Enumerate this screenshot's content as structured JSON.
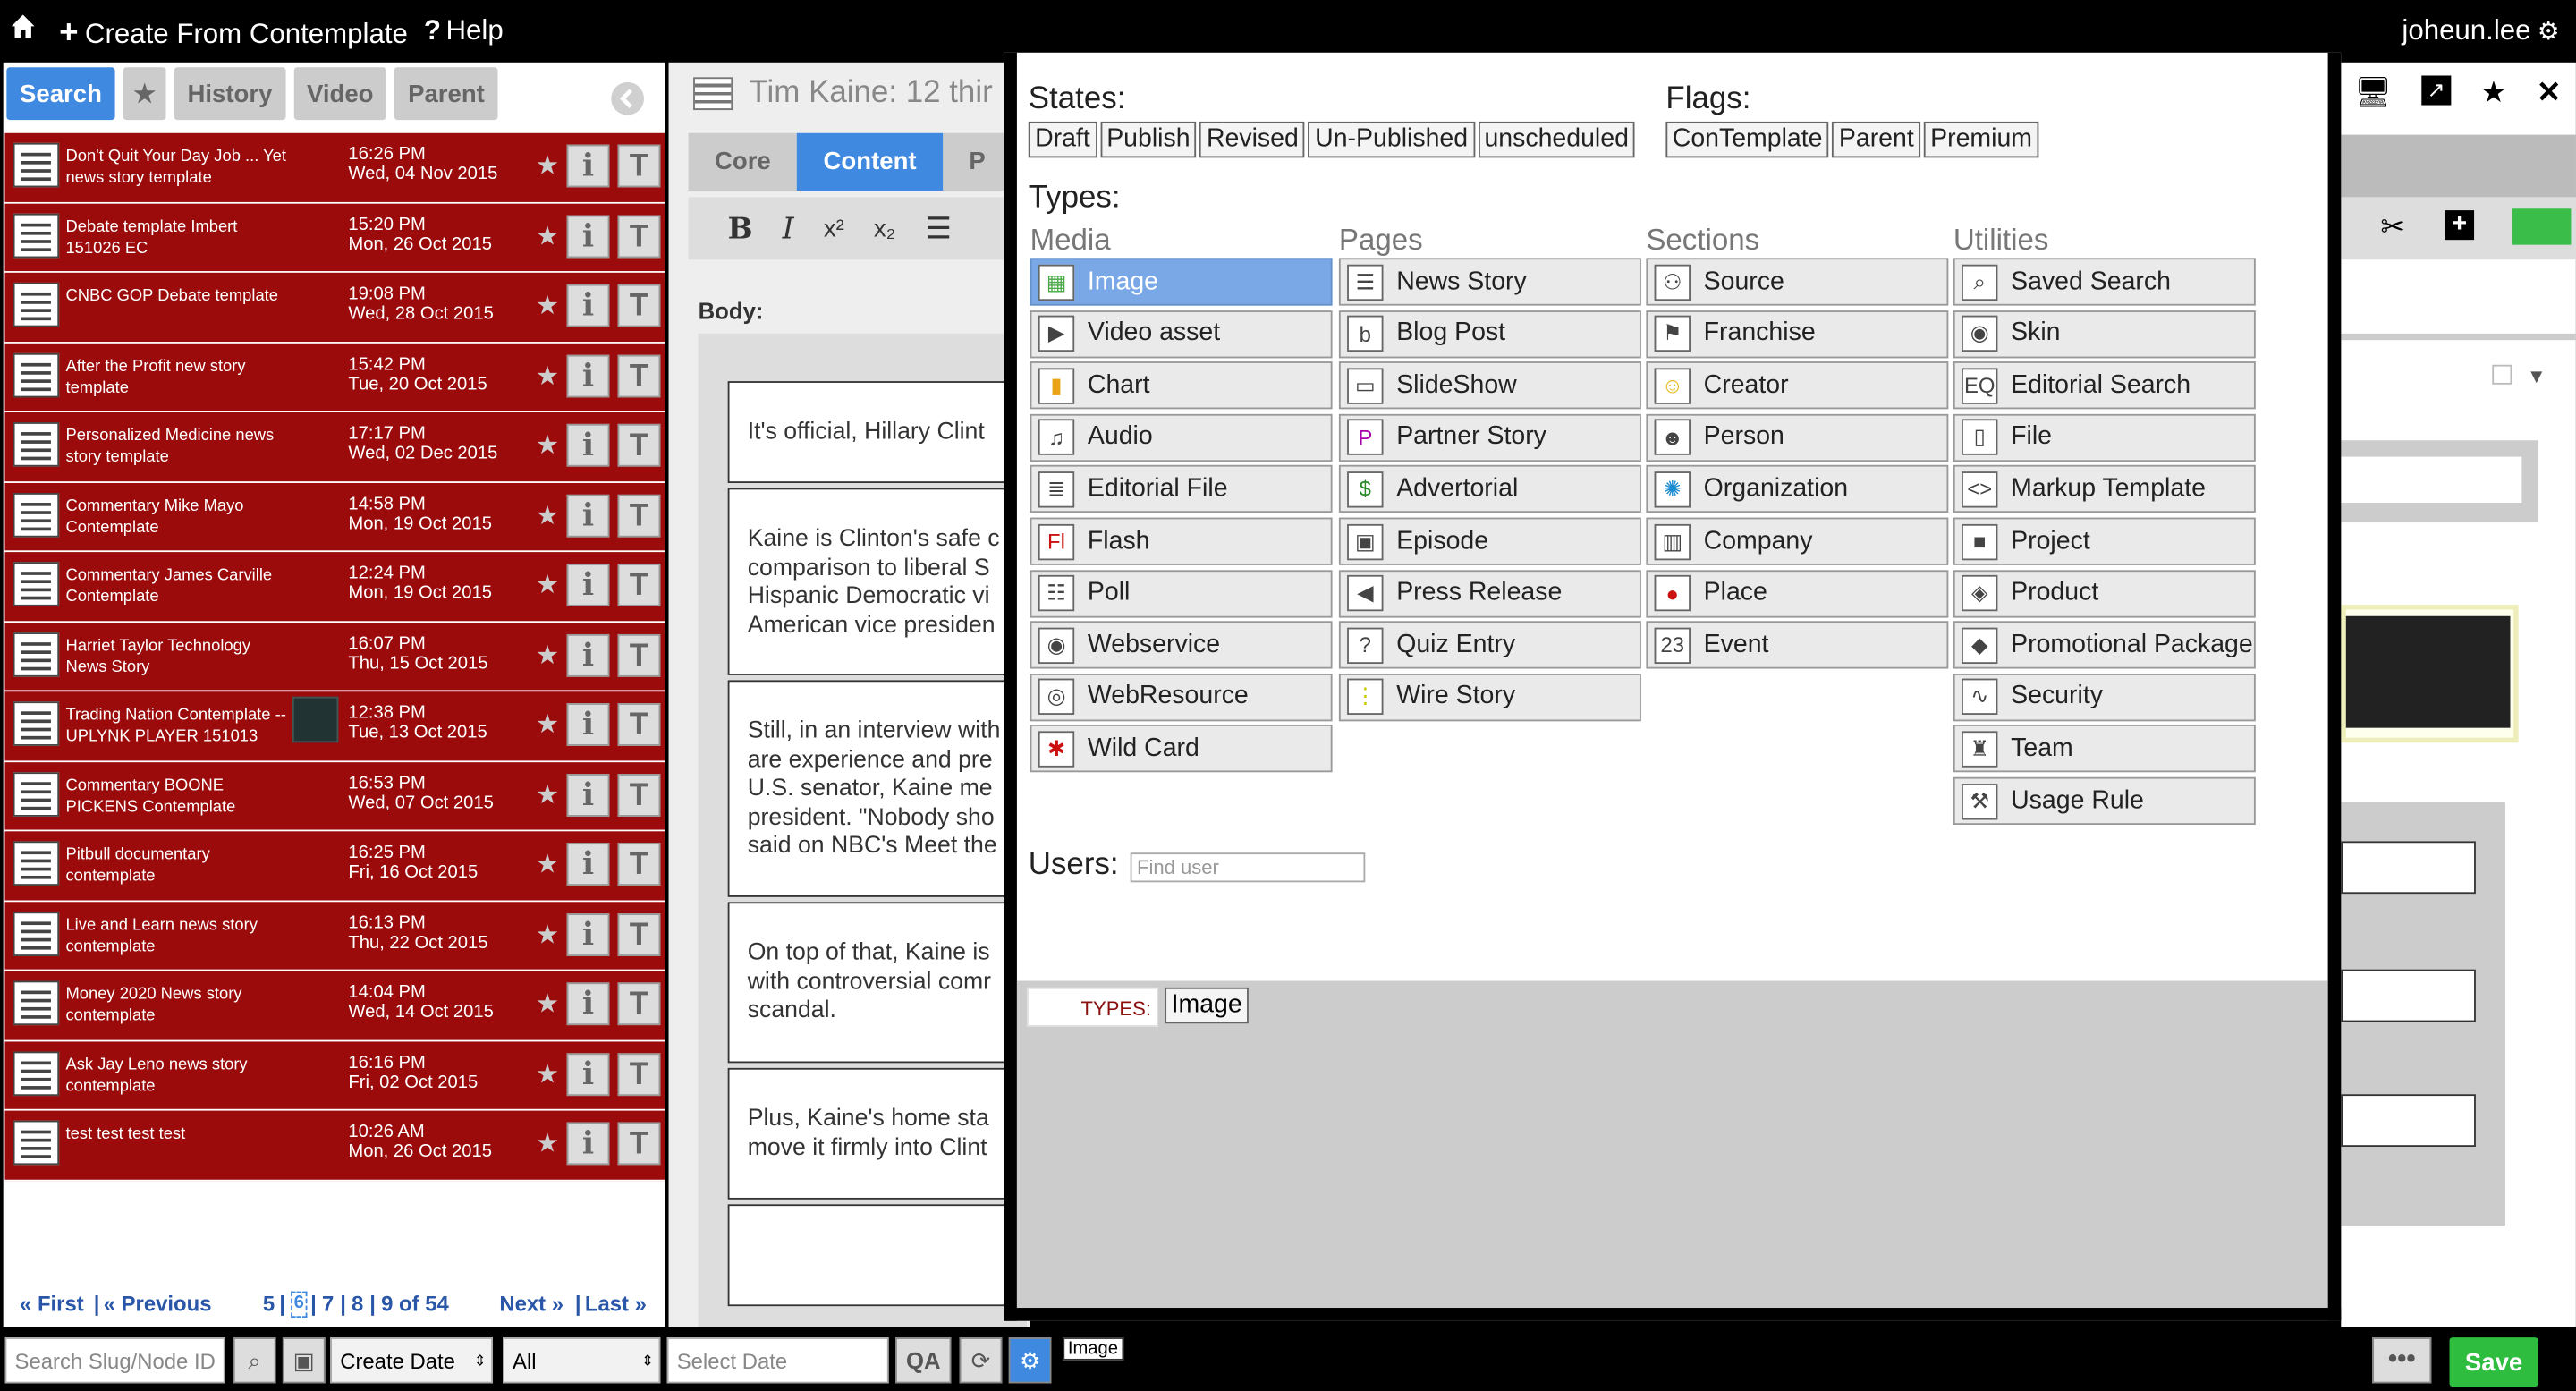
{
  "topbar": {
    "create_label": "Create From Contemplate",
    "help_label": "Help",
    "user": "joheun.lee"
  },
  "left": {
    "tabs": [
      "Search",
      "★",
      "History",
      "Video",
      "Parent"
    ],
    "items": [
      {
        "title": "Don't Quit Your Day Job ... Yet news story template",
        "time": "16:26 PM",
        "date": "Wed, 04 Nov 2015"
      },
      {
        "title": "Debate template Imbert 151026 EC",
        "time": "15:20 PM",
        "date": "Mon, 26 Oct 2015"
      },
      {
        "title": "CNBC GOP Debate template",
        "time": "19:08 PM",
        "date": "Wed, 28 Oct 2015"
      },
      {
        "title": "After the Profit new story template",
        "time": "15:42 PM",
        "date": "Tue, 20 Oct 2015"
      },
      {
        "title": "Personalized Medicine news story template",
        "time": "17:17 PM",
        "date": "Wed, 02 Dec 2015"
      },
      {
        "title": "Commentary Mike Mayo Contemplate",
        "time": "14:58 PM",
        "date": "Mon, 19 Oct 2015"
      },
      {
        "title": "Commentary James Carville Contemplate",
        "time": "12:24 PM",
        "date": "Mon, 19 Oct 2015"
      },
      {
        "title": "Harriet Taylor Technology News Story",
        "time": "16:07 PM",
        "date": "Thu, 15 Oct 2015"
      },
      {
        "title": "Trading Nation Contemplate -- UPLYNK PLAYER 151013",
        "time": "12:38 PM",
        "date": "Tue, 13 Oct 2015"
      },
      {
        "title": "Commentary BOONE PICKENS Contemplate",
        "time": "16:53 PM",
        "date": "Wed, 07 Oct 2015"
      },
      {
        "title": "Pitbull documentary contemplate",
        "time": "16:25 PM",
        "date": "Fri, 16 Oct 2015"
      },
      {
        "title": "Live and Learn news story contemplate",
        "time": "16:13 PM",
        "date": "Thu, 22 Oct 2015"
      },
      {
        "title": "Money 2020 News story contemplate",
        "time": "14:04 PM",
        "date": "Wed, 14 Oct 2015"
      },
      {
        "title": "Ask Jay Leno news story contemplate",
        "time": "16:16 PM",
        "date": "Fri, 02 Oct 2015"
      },
      {
        "title": "test test test test",
        "time": "10:26 AM",
        "date": "Mon, 26 Oct 2015"
      }
    ],
    "pager": {
      "first": "« First",
      "prev": "« Previous",
      "pages": [
        "5",
        "6",
        "7",
        "8"
      ],
      "sep": "|",
      "of": "9 of 54",
      "next": "Next »",
      "last": "Last »"
    }
  },
  "center": {
    "title": "Tim Kaine: 12 thir",
    "tabs": [
      "Core",
      "Content",
      "P"
    ],
    "body_label": "Body:",
    "paras": [
      [
        "It's official, Hillary Clint"
      ],
      [
        "Kaine is Clinton's safe c",
        "comparison to liberal S",
        "Hispanic Democratic vi",
        "American vice presiden"
      ],
      [
        "Still, in an interview with",
        "are experience and pre",
        "U.S. senator, Kaine me",
        "president. \"Nobody sho",
        "said on NBC's Meet the"
      ],
      [
        "On top of that, Kaine is",
        "with controversial comr",
        "scandal."
      ],
      [
        "Plus, Kaine's home sta",
        "move it firmly into Clint"
      ],
      [
        ""
      ]
    ]
  },
  "popup": {
    "states_label": "States:",
    "states": [
      "Draft",
      "Publish",
      "Revised",
      "Un-Published",
      "unscheduled"
    ],
    "flags_label": "Flags:",
    "flags": [
      "ConTemplate",
      "Parent",
      "Premium"
    ],
    "types_label": "Types:",
    "columns": [
      {
        "header": "Media",
        "items": [
          "Image",
          "Video asset",
          "Chart",
          "Audio",
          "Editorial File",
          "Flash",
          "Poll",
          "Webservice",
          "WebResource",
          "Wild Card"
        ]
      },
      {
        "header": "Pages",
        "items": [
          "News Story",
          "Blog Post",
          "SlideShow",
          "Partner Story",
          "Advertorial",
          "Episode",
          "Press Release",
          "Quiz Entry",
          "Wire Story"
        ]
      },
      {
        "header": "Sections",
        "items": [
          "Source",
          "Franchise",
          "Creator",
          "Person",
          "Organization",
          "Company",
          "Place",
          "Event"
        ]
      },
      {
        "header": "Utilities",
        "items": [
          "Saved Search",
          "Skin",
          "Editorial Search",
          "File",
          "Markup Template",
          "Project",
          "Product",
          "Promotional Package",
          "Security",
          "Team",
          "Usage Rule"
        ]
      }
    ],
    "users_label": "Users:",
    "find_user_placeholder": "Find user",
    "footer": {
      "types_label": "TYPES:",
      "selected": "Image"
    }
  },
  "bottom": {
    "search_placeholder": "Search Slug/Node ID",
    "sort": "Create Date",
    "filter": "All",
    "date_placeholder": "Select Date",
    "tooltip": "Image",
    "more": "•••",
    "save": "Save"
  }
}
